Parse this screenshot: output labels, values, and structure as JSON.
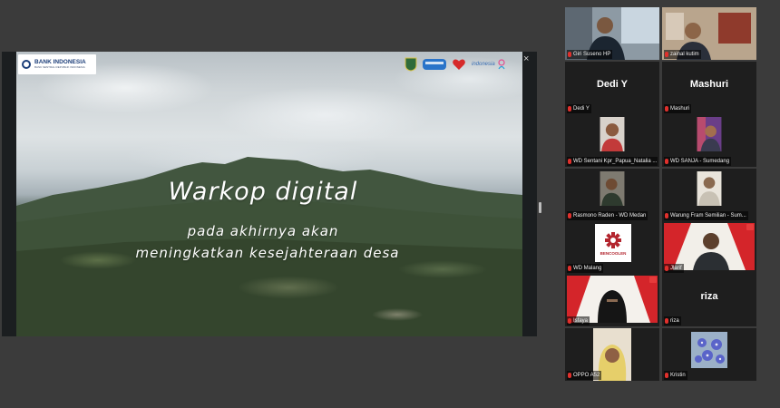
{
  "share": {
    "org_logo": "BANK INDONESIA",
    "org_tagline": "BANK SENTRAL REPUBLIK INDONESIA",
    "close_glyph": "×",
    "title": "Warkop digital",
    "subtitle_line1": "pada akhirnya akan",
    "subtitle_line2": "meningkatkan kesejahteraan desa",
    "partner_logo_text": "indonesia"
  },
  "gallery": {
    "active_color": "#23d160",
    "participants": [
      {
        "name": "Giri Suseno HP",
        "mode": "video",
        "active": true,
        "muted": true
      },
      {
        "name": "zainal kutim",
        "mode": "video",
        "muted": true
      },
      {
        "name": "Dedi Y",
        "display": "Dedi Y",
        "mode": "name",
        "muted": true
      },
      {
        "name": "Mashuri",
        "display": "Mashuri",
        "mode": "name",
        "muted": true
      },
      {
        "name": "WD Sentani Kpr_Papua_Natalia ...",
        "mode": "video",
        "muted": true
      },
      {
        "name": "WD SANJA - Sumedang",
        "mode": "video",
        "muted": true
      },
      {
        "name": "Rasmono Raden - WD Medan",
        "mode": "video",
        "muted": true
      },
      {
        "name": "Warung Fram Semilian - Sum...",
        "mode": "video",
        "muted": true
      },
      {
        "name": "WD Malang",
        "mode": "video",
        "muted": true,
        "logo_text": "BENCOOLEN"
      },
      {
        "name": "Jlarif",
        "mode": "video",
        "muted": true
      },
      {
        "name": "Isfaya",
        "mode": "video",
        "muted": true
      },
      {
        "name": "riza",
        "display": "riza",
        "mode": "name",
        "muted": true
      },
      {
        "name": "OPPO A52",
        "mode": "video",
        "muted": true
      },
      {
        "name": "Kristin",
        "mode": "video",
        "muted": true
      }
    ]
  }
}
